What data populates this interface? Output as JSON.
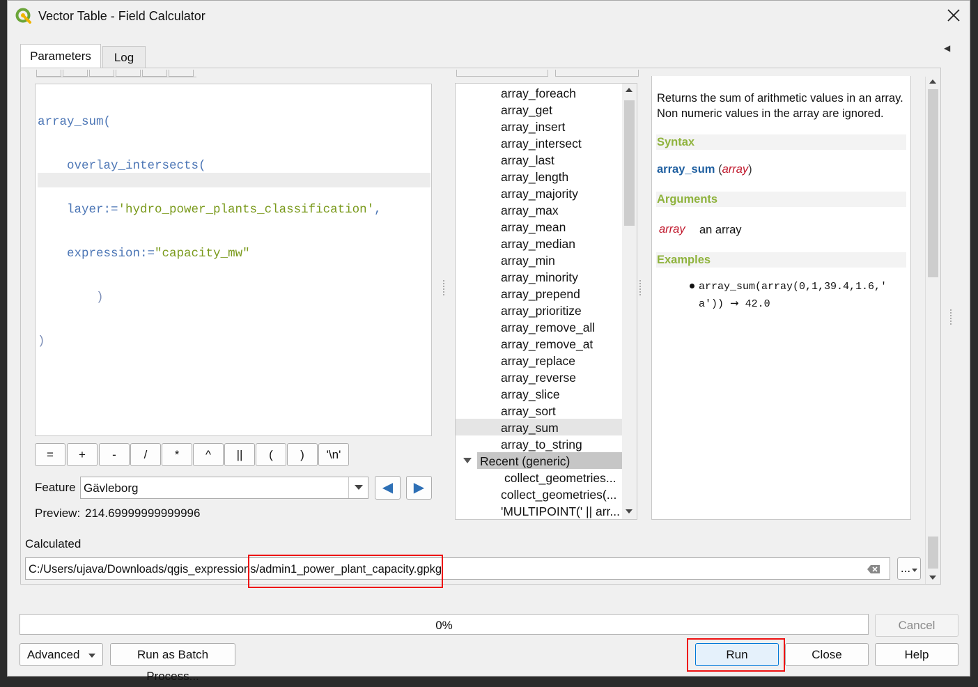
{
  "window": {
    "title": "Vector Table - Field Calculator",
    "collapse_glyph": "◀"
  },
  "tabs": [
    {
      "label": "Parameters",
      "active": true
    },
    {
      "label": "Log",
      "active": false
    }
  ],
  "expression": {
    "line1": "array_sum(",
    "line2": "overlay_intersects(",
    "line3_key": "layer:=",
    "line3_val": "'hydro_power_plants_classification'",
    "line3_end": ",",
    "line4_key": "expression:=",
    "line4_val": "\"capacity_mw\"",
    "line5": ")",
    "line6": ")"
  },
  "operators": [
    "=",
    "+",
    "-",
    "/",
    "*",
    "^",
    "||",
    "(",
    ")",
    "'\\n'"
  ],
  "feature": {
    "label": "Feature",
    "value": "Gävleborg",
    "prev_icon": "◀",
    "next_icon": "▶"
  },
  "preview": {
    "label": "Preview:",
    "value": "214.69999999999996"
  },
  "function_list": {
    "items": [
      "array_foreach",
      "array_get",
      "array_insert",
      "array_intersect",
      "array_last",
      "array_length",
      "array_majority",
      "array_max",
      "array_mean",
      "array_median",
      "array_min",
      "array_minority",
      "array_prepend",
      "array_prioritize",
      "array_remove_all",
      "array_remove_at",
      "array_replace",
      "array_reverse",
      "array_slice",
      "array_sort",
      "array_sum",
      "array_to_string"
    ],
    "selected": "array_sum",
    "group": "Recent (generic)",
    "recent": [
      "collect_geometries...",
      "collect_geometries(...",
      "'MULTIPOINT(' || arr..."
    ]
  },
  "help": {
    "description": "Returns the sum of arithmetic values in an array. Non numeric values in the array are ignored.",
    "syntax_heading": "Syntax",
    "syntax_fn": "array_sum",
    "syntax_arg": "array",
    "arguments_heading": "Arguments",
    "arg_name": "array",
    "arg_desc": "an array",
    "examples_heading": "Examples",
    "example_line1": "array_sum(array(0,1,39.4,1.6,'",
    "example_line2": "a'))",
    "example_result": "42.0"
  },
  "output": {
    "label": "Calculated",
    "path": "C:/Users/ujava/Downloads/qgis_expressions/admin1_power_plant_capacity.gpkg",
    "browse_label": "..."
  },
  "progress": {
    "value": 0,
    "text": "0%"
  },
  "buttons": {
    "cancel": "Cancel",
    "advanced": "Advanced",
    "batch": "Run as Batch Process...",
    "run": "Run",
    "close": "Close",
    "help": "Help"
  },
  "colors": {
    "highlight_box": "#e11111",
    "help_heading": "#8fb33d",
    "function_name": "#1f5fa0",
    "argument": "#c0172b"
  }
}
